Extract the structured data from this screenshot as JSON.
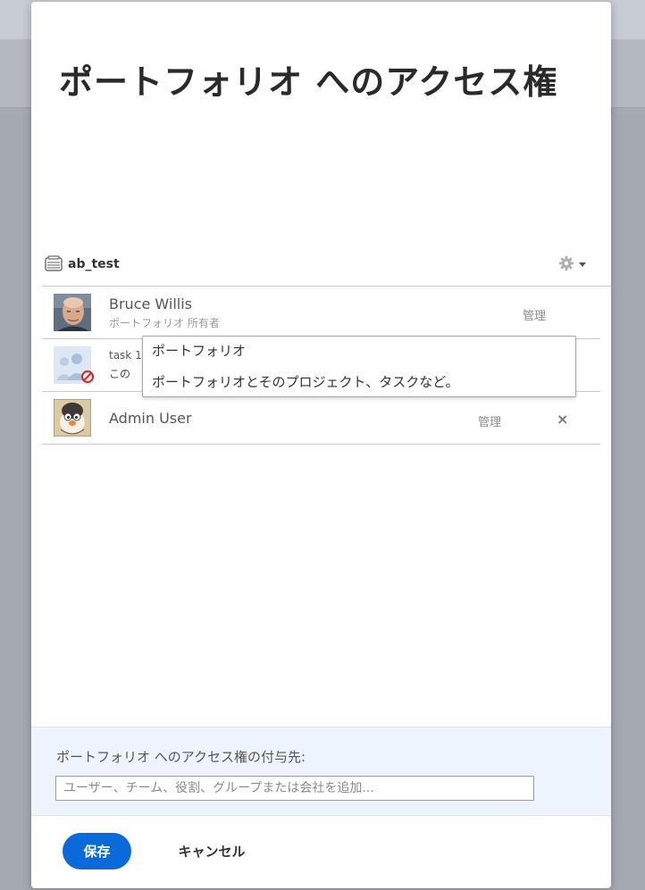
{
  "dialog": {
    "title": "ポートフォリオ へのアクセス権"
  },
  "object": {
    "name": "ab_test",
    "icon": "portfolio-icon",
    "settings_icon": "gear-icon"
  },
  "users": [
    {
      "name": "Bruce Willis",
      "subtitle": "ポートフォリオ 所有者",
      "permission": "管理"
    },
    {
      "name": "task 1",
      "subtitle": "この",
      "permission": ""
    },
    {
      "name": "Admin User",
      "subtitle": "",
      "permission": "管理",
      "remove": "×"
    }
  ],
  "tooltip": {
    "line1": "ポートフォリオ",
    "line2": "ポートフォリオとそのプロジェクト、タスクなど。"
  },
  "share": {
    "label": "ポートフォリオ へのアクセス権の付与先:",
    "placeholder": "ユーザー、チーム、役割、グループまたは会社を追加..."
  },
  "buttons": {
    "save": "保存",
    "cancel": "キャンセル"
  },
  "colors": {
    "primary": "#0b6ad9",
    "share_bg": "#eef4fd",
    "overlay": "#a5a9b1"
  }
}
